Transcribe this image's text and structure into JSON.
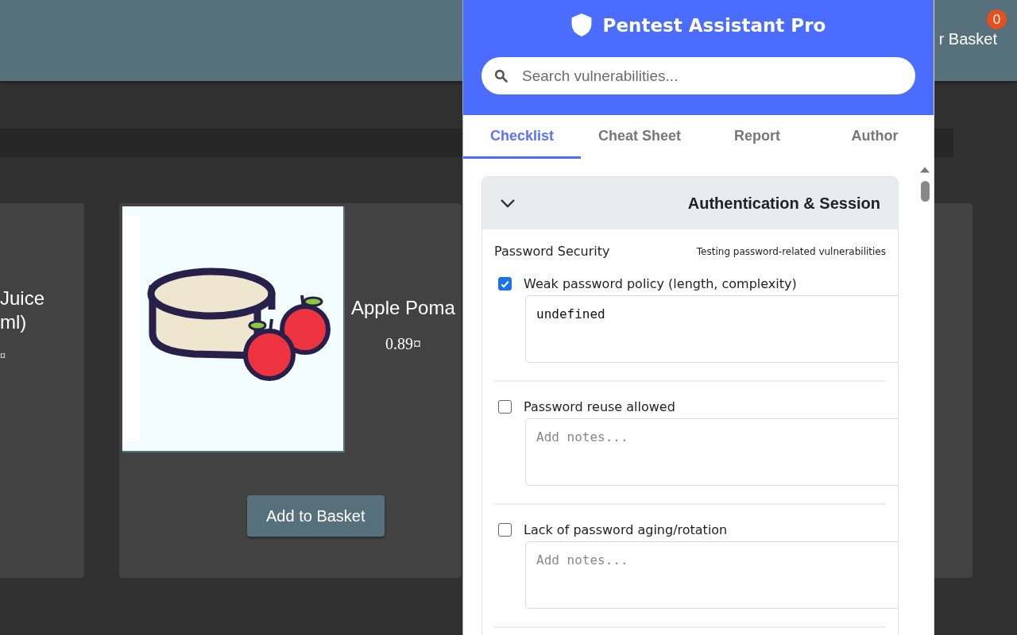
{
  "shop": {
    "basket_label": "r Basket",
    "basket_count": "0",
    "products": [
      {
        "kind": "partial",
        "lines": [
          "Juice",
          "ml)"
        ],
        "price": "¤"
      },
      {
        "kind": "full",
        "name": "Apple Poma",
        "price": "0.89¤",
        "button": "Add to Basket"
      }
    ]
  },
  "extension": {
    "title": "Pentest Assistant Pro",
    "search": {
      "placeholder": "Search vulnerabilities..."
    },
    "tabs": [
      {
        "label": "Checklist",
        "selected": true
      },
      {
        "label": "Cheat Sheet",
        "selected": false
      },
      {
        "label": "Report",
        "selected": false
      },
      {
        "label": "Author",
        "selected": false
      }
    ],
    "category": {
      "title": "Authentication & Session",
      "expanded": true,
      "section": {
        "title": "Password Security",
        "description": "Testing password-related vulnerabilities",
        "items": [
          {
            "label": "Weak password policy (length, complexity)",
            "checked": true,
            "notes": "undefined"
          },
          {
            "label": "Password reuse allowed",
            "checked": false,
            "placeholder": "Add notes..."
          },
          {
            "label": "Lack of password aging/rotation",
            "checked": false,
            "placeholder": "Add notes..."
          }
        ]
      }
    }
  }
}
